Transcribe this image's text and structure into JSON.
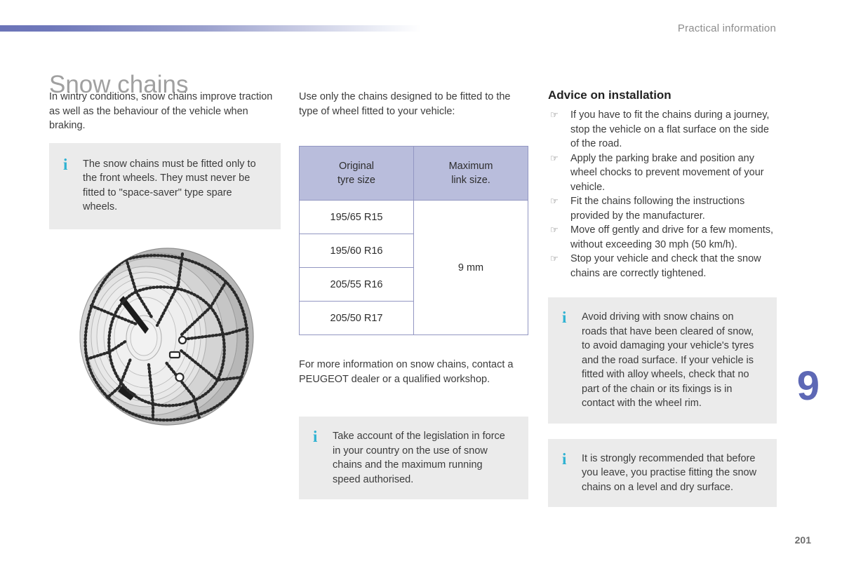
{
  "header": {
    "section_title": "Practical information",
    "rule_color_start": "#6b74b8",
    "rule_color_end": "#ffffff"
  },
  "page": {
    "title": "Snow chains",
    "chapter_number": "9",
    "page_number": "201",
    "chapter_color": "#5d68b5"
  },
  "left_column": {
    "intro": "In wintry conditions, snow chains improve traction as well as the behaviour of the vehicle when braking.",
    "info_box": {
      "icon": "info-i-icon",
      "icon_color": "#2fb2d2",
      "background": "#ebebeb",
      "text": "The snow chains must be fitted only to the front wheels. They must never be fitted to \"space-saver\" type spare wheels."
    },
    "figure": {
      "name": "wheel-with-snow-chains-illustration",
      "alt": "Car wheel fitted with snow chains"
    }
  },
  "middle_column": {
    "intro": "Use only the chains designed to be fitted to the type of wheel fitted to your vehicle:",
    "table": {
      "header_background": "#b9bddc",
      "border_color": "#9296c2",
      "columns": [
        {
          "line1": "Original",
          "line2": "tyre size"
        },
        {
          "line1": "Maximum",
          "line2": "link size."
        }
      ],
      "rows": [
        "195/65 R15",
        "195/60 R16",
        "205/55 R16",
        "205/50 R17"
      ],
      "merged_value": "9 mm"
    },
    "footnote": "For more information on snow chains, contact a PEUGEOT dealer or a qualified workshop.",
    "info_box": {
      "icon": "info-i-icon",
      "icon_color": "#2fb2d2",
      "background": "#ebebeb",
      "text": "Take account of the legislation in force in your country on the use of snow chains and the maximum running speed authorised."
    }
  },
  "right_column": {
    "heading": "Advice on installation",
    "bullet_icon": "pointing-hand-icon",
    "bullets": [
      "If you have to fit the chains during a journey, stop the vehicle on a flat surface on the side of the road.",
      "Apply the parking brake and position any wheel chocks to prevent movement of your vehicle.",
      "Fit the chains following the instructions provided by the manufacturer.",
      "Move off gently and drive for a few moments, without exceeding 30 mph (50 km/h).",
      "Stop your vehicle and check that the snow chains are correctly tightened."
    ],
    "info_box_1": {
      "icon": "info-i-icon",
      "icon_color": "#2fb2d2",
      "background": "#ebebeb",
      "text": "Avoid driving with snow chains on roads that have been cleared of snow, to avoid damaging your vehicle's tyres and the road surface. If your vehicle is fitted with alloy wheels, check that no part of the chain or its fixings is in contact with the wheel rim."
    },
    "info_box_2": {
      "icon": "info-i-icon",
      "icon_color": "#2fb2d2",
      "background": "#ebebeb",
      "text": "It is strongly recommended that before you leave, you practise fitting the snow chains on a level and dry surface."
    }
  }
}
